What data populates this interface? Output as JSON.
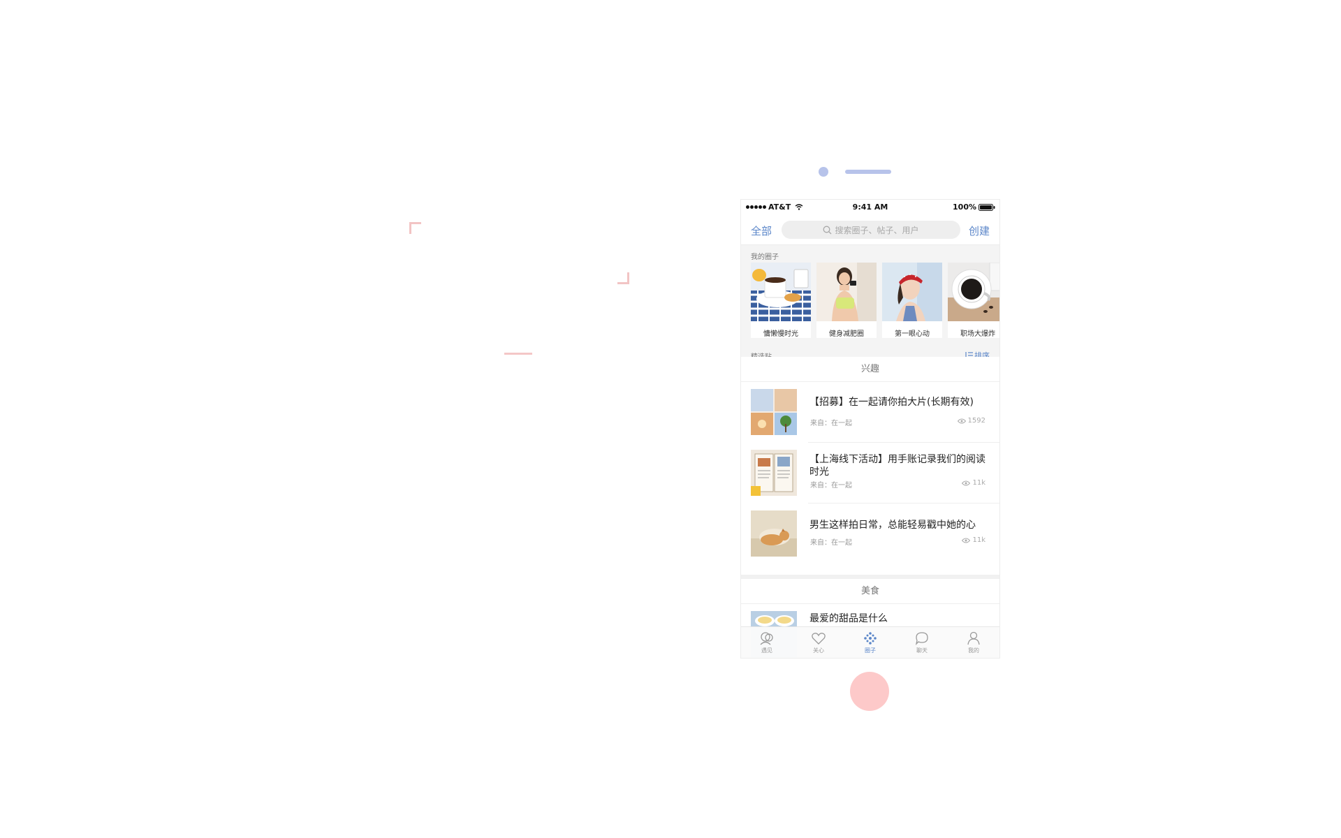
{
  "intro": {
    "title": "",
    "line1": "",
    "line2": ""
  },
  "status_bar": {
    "carrier": "AT&T",
    "time": "9:41 AM",
    "battery": "100%"
  },
  "nav": {
    "left_label": "全部",
    "search_placeholder": "搜索圈子、帖子、用户",
    "right_label": "创建"
  },
  "my_circles": {
    "label": "我的圈子",
    "items": [
      {
        "name": "慵懒慢时光"
      },
      {
        "name": "健身减肥圈"
      },
      {
        "name": "第一眼心动"
      },
      {
        "name": "职场大爆炸"
      }
    ]
  },
  "featured": {
    "label": "精选贴",
    "sort_label": "排序"
  },
  "categories": [
    {
      "name": "兴趣",
      "posts": [
        {
          "title": "【招募】在一起请你拍大片(长期有效)",
          "source": "来自：在一起",
          "views": "1592"
        },
        {
          "title": "【上海线下活动】用手账记录我们的阅读时光",
          "source": "来自：在一起",
          "views": "11k"
        },
        {
          "title": "男生这样拍日常，总能轻易戳中她的心",
          "source": "来自：在一起",
          "views": "11k"
        }
      ]
    },
    {
      "name": "美食",
      "posts": [
        {
          "title": "最爱的甜品是什么"
        }
      ]
    }
  ],
  "tab_bar": [
    {
      "label": "遇见",
      "icon": "meet-icon"
    },
    {
      "label": "关心",
      "icon": "heart-icon"
    },
    {
      "label": "圈子",
      "icon": "circle-dots-icon",
      "active": true
    },
    {
      "label": "聊天",
      "icon": "chat-bubble-icon"
    },
    {
      "label": "我的",
      "icon": "person-icon"
    }
  ],
  "colors": {
    "accent": "#5b86c9",
    "indicator": "#b7c3ea",
    "home_button": "#fdc9c9",
    "bracket": "#f2c4c4"
  }
}
